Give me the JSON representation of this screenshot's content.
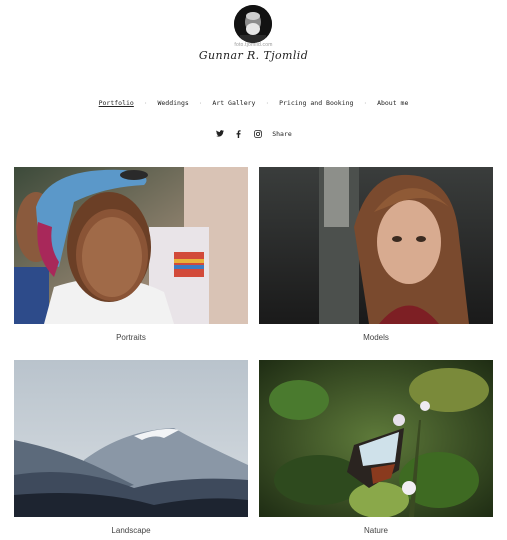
{
  "header": {
    "domain": "foto.tjomlid.com",
    "name": "Gunnar R. Tjomlid"
  },
  "nav": {
    "items": [
      {
        "label": "Portfolio",
        "active": true
      },
      {
        "label": "Weddings",
        "active": false
      },
      {
        "label": "Art Gallery",
        "active": false
      },
      {
        "label": "Pricing and Booking",
        "active": false
      },
      {
        "label": "About me",
        "active": false
      }
    ],
    "separator": "·"
  },
  "social": {
    "icons": [
      "twitter-icon",
      "facebook-icon",
      "instagram-icon"
    ],
    "share_label": "Share"
  },
  "gallery": [
    {
      "caption": "Portraits"
    },
    {
      "caption": "Models"
    },
    {
      "caption": "Landscape"
    },
    {
      "caption": "Nature"
    }
  ]
}
